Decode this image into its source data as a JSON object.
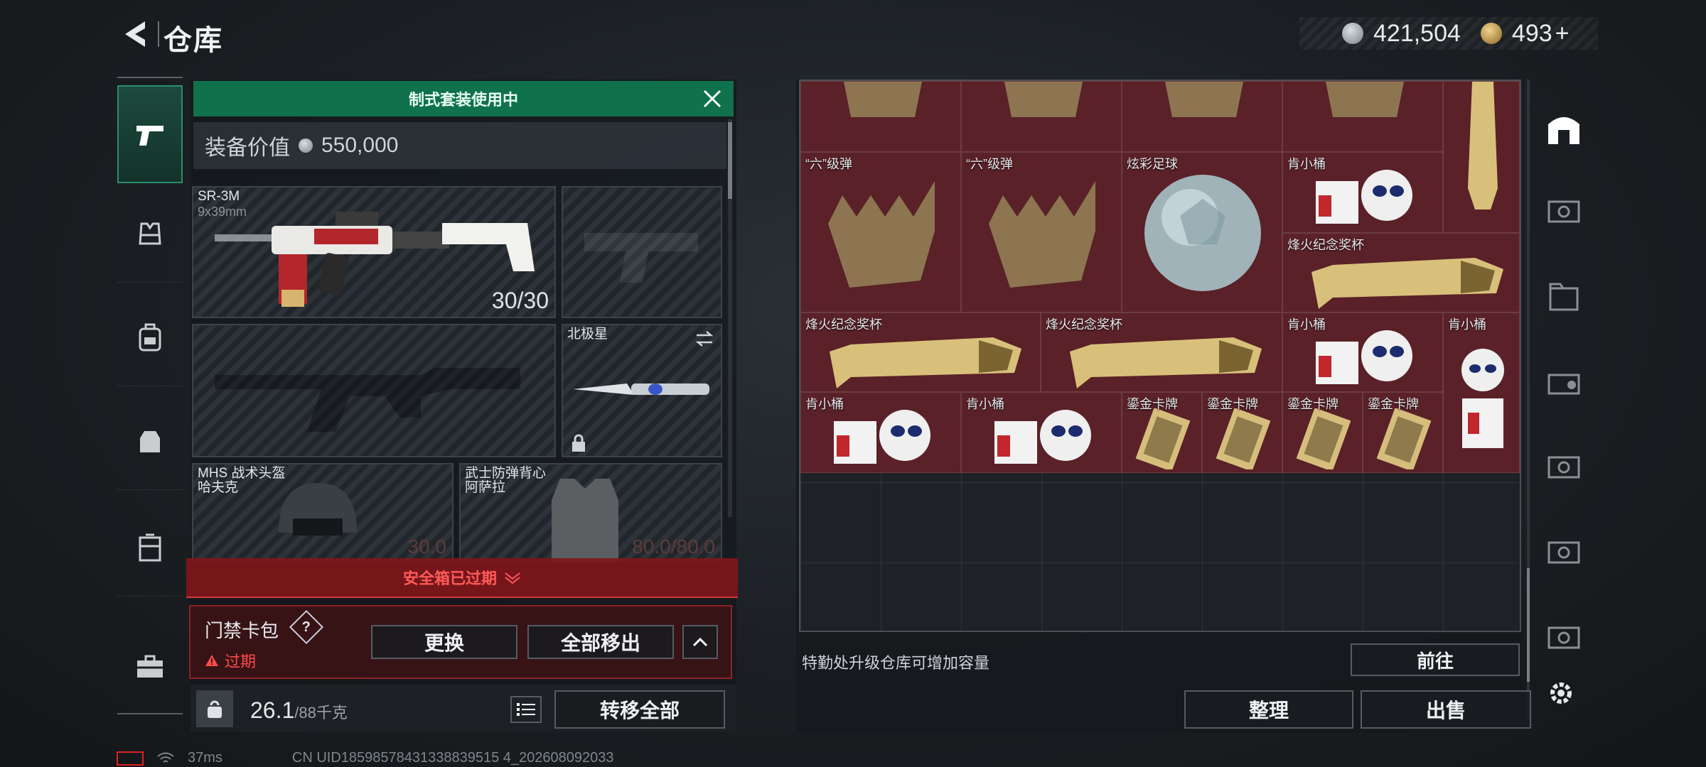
{
  "header": {
    "title": "仓库",
    "silver": "421,504",
    "gold": "493",
    "gold_plus": "+"
  },
  "loadout": {
    "banner": "制式套装使用中",
    "value_label": "装备价值",
    "value": "550,000",
    "primary": {
      "name": "SR-3M",
      "ammo_type": "9x39mm",
      "count": "30/30"
    },
    "melee": {
      "name": "北极星"
    },
    "helmet": {
      "name": "MHS 战术头盔",
      "sub": "哈夫克",
      "durability": "30.0"
    },
    "armor": {
      "name": "武士防弹背心",
      "sub": "阿萨拉",
      "durability": "80.0/80.0"
    }
  },
  "safebox": {
    "status": "安全箱已过期",
    "keycard_label": "门禁卡包",
    "help": "?",
    "expired": "过期",
    "replace_btn": "更换",
    "remove_all_btn": "全部移出"
  },
  "weight": {
    "value": "26.1",
    "cap": "/88千克"
  },
  "transfer_all_btn": "转移全部",
  "storage": {
    "items": [
      {
        "name": "“六”级弹"
      },
      {
        "name": "“六”级弹"
      },
      {
        "name": "炫彩足球"
      },
      {
        "name": "肯小桶"
      },
      {
        "name": "烽火纪念奖杯"
      },
      {
        "name": "烽火纪念奖杯"
      },
      {
        "name": "烽火纪念奖杯"
      },
      {
        "name": "肯小桶"
      },
      {
        "name": "肯小桶"
      },
      {
        "name": "肯小桶"
      },
      {
        "name": "肯小桶"
      },
      {
        "name": "鎏金卡牌"
      },
      {
        "name": "鎏金卡牌"
      },
      {
        "name": "鎏金卡牌"
      },
      {
        "name": "鎏金卡牌"
      }
    ],
    "upgrade_note": "特勤处升级仓库可增加容量",
    "goto_btn": "前往",
    "sort_btn": "整理",
    "sell_btn": "出售"
  },
  "status": {
    "ping": "37ms",
    "uid": "CN UID18598578431338839515 4_202608092033"
  },
  "colors": {
    "accent_green": "#10714d",
    "warning_red": "#ff4a4a",
    "item_bg": "#5a2128"
  }
}
